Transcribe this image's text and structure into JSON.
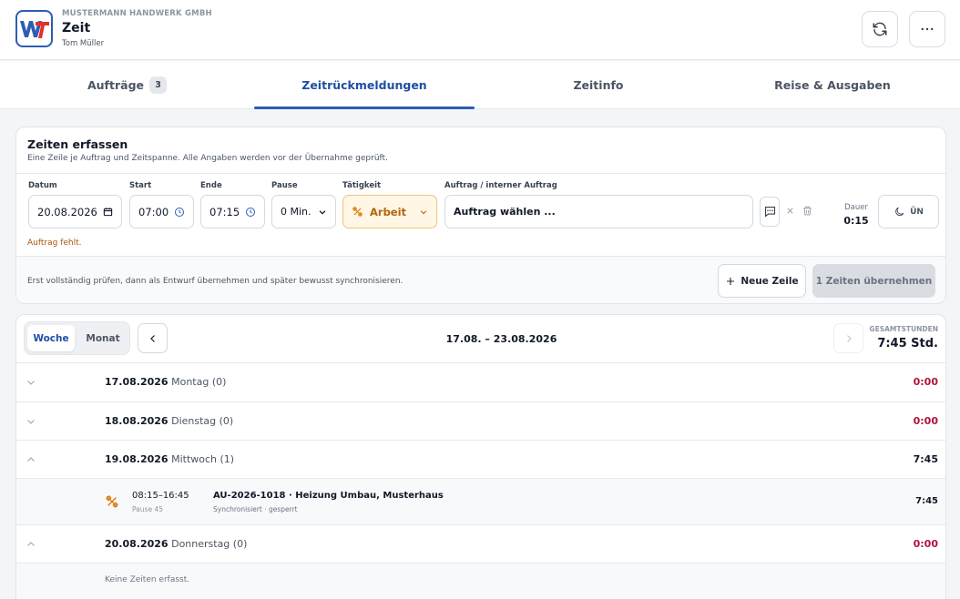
{
  "header": {
    "logo_text": "WT",
    "company": "MUSTERMANN HANDWERK GMBH",
    "title": "Zeit",
    "user": "Tom Müller"
  },
  "tabs": [
    {
      "label": "Aufträge",
      "count": "3"
    },
    {
      "label": "Zeitrückmeldungen",
      "active": true
    },
    {
      "label": "Zeitinfo"
    },
    {
      "label": "Reise & Ausgaben"
    }
  ],
  "entry": {
    "title": "Zeiten erfassen",
    "subtitle": "Eine Zeile je Auftrag und Zeitspanne. Alle Angaben werden vor der Übernahme geprüft.",
    "labels": {
      "datum": "Datum",
      "start": "Start",
      "ende": "Ende",
      "pause": "Pause",
      "taetigkeit": "Tätigkeit",
      "auftrag": "Auftrag / interner Auftrag",
      "dauer": "Dauer"
    },
    "values": {
      "datum": "20.08.2026",
      "start": "07:00",
      "ende": "07:15",
      "pause": "0 Min.",
      "taetigkeit": "Arbeit",
      "auftrag": "Auftrag wählen ...",
      "dauer": "0:15",
      "toggle": "ÜN"
    },
    "error": "Auftrag fehlt.",
    "footer_hint": "Erst vollständig prüfen, dann als Entwurf übernehmen und später bewusst synchronisieren.",
    "new_row": "Neue Zeile",
    "apply": "1 Zeiten übernehmen"
  },
  "week": {
    "seg_week": "Woche",
    "seg_month": "Monat",
    "range": "17.08. – 23.08.2026",
    "total_label": "GESAMTSTUNDEN",
    "total_value": "7:45 Std.",
    "days": [
      {
        "date": "17.08.2026",
        "name": "Montag (0)",
        "total": "0:00"
      },
      {
        "date": "18.08.2026",
        "name": "Dienstag (0)",
        "total": "0:00"
      },
      {
        "date": "19.08.2026",
        "name": "Mittwoch (1)",
        "total": "7:45"
      },
      {
        "date": "20.08.2026",
        "name": "Donnerstag (0)",
        "total": "0:00"
      }
    ],
    "entry": {
      "time": "08:15–16:45",
      "pause": "Pause 45",
      "order": "AU-2026-1018 · Heizung Umbau, Musterhaus",
      "status": "Synchronisiert · gesperrt",
      "total": "7:45"
    },
    "empty": "Keine Zeiten erfasst."
  },
  "colors": {
    "accent": "#1f4fa3",
    "warning": "#b3650c",
    "zero_total": "#b0133e"
  }
}
